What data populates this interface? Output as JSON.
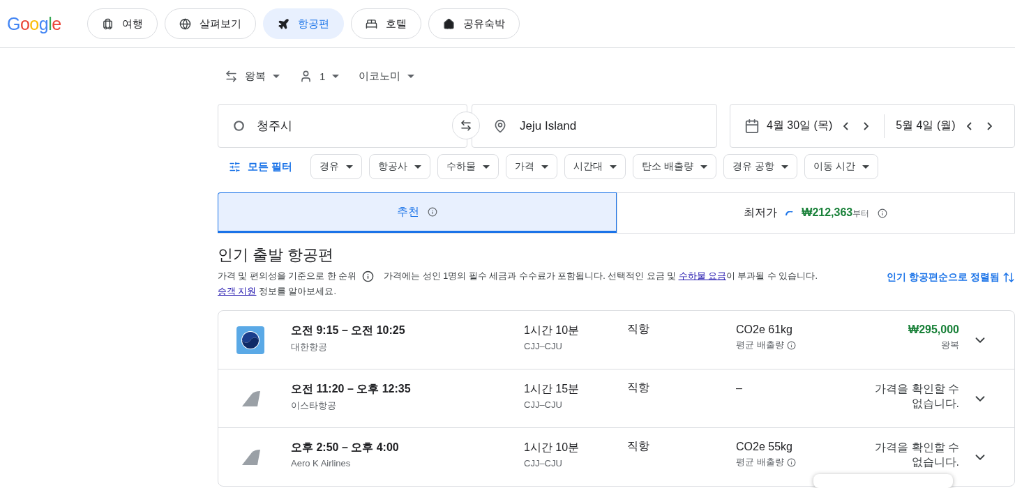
{
  "logo": "Google",
  "nav": [
    {
      "label": "여행",
      "selected": false
    },
    {
      "label": "살펴보기",
      "selected": false
    },
    {
      "label": "항공편",
      "selected": true
    },
    {
      "label": "호텔",
      "selected": false
    },
    {
      "label": "공유숙박",
      "selected": false
    }
  ],
  "options": [
    {
      "kind": "trip",
      "label": "왕복"
    },
    {
      "kind": "people",
      "label": "1"
    },
    {
      "kind": "class",
      "label": "이코노미"
    }
  ],
  "origin": "청주시",
  "destination": "Jeju Island",
  "dates": [
    {
      "label": "4월 30일 (목)"
    },
    {
      "label": "5월 4일 (월)"
    }
  ],
  "all_filters": "모든 필터",
  "filters": [
    "경유",
    "항공사",
    "수하물",
    "가격",
    "시간대",
    "탄소 배출량",
    "경유 공항",
    "이동 시간"
  ],
  "sort_tabs": [
    {
      "label": "추천",
      "selected": true
    },
    {
      "label": "최저가",
      "selected": false,
      "price": "₩212,363",
      "suffix": "부터"
    }
  ],
  "section": {
    "title": "인기 출발 항공편",
    "rank_note": "가격 및 편의성을 기준으로 한 순위",
    "price_note": "가격에는 성인 1명의 필수 세금과 수수료가 포함됩니다. 선택적인 요금 및 ",
    "baggage_link": "수하물 요금",
    "price_note_end": "이 부과될 수 있습니다.",
    "support_link": "승객 지원",
    "support_end": " 정보를 알아보세요.",
    "sort_label": "인기 항공편순으로 정렬됨"
  },
  "flights": [
    {
      "kind": "logo",
      "times": "오전 9:15 – 오전 10:25",
      "airline": "대한항공",
      "duration": "1시간 10분",
      "route": "CJJ–CJU",
      "stops": "직항",
      "emissions": "CO2e 61kg",
      "emissions_note": "평균 배출량",
      "price": "₩295,000",
      "price_note": "왕복"
    },
    {
      "kind": "tail",
      "times": "오전 11:20 – 오후 12:35",
      "airline": "이스타항공",
      "duration": "1시간 15분",
      "route": "CJJ–CJU",
      "stops": "직항",
      "emissions": "–",
      "unavailable": "가격을 확인할 수 없습니다."
    },
    {
      "kind": "tail",
      "times": "오후 2:50 – 오후 4:00",
      "airline": "Aero K Airlines",
      "duration": "1시간 10분",
      "route": "CJJ–CJU",
      "stops": "직항",
      "emissions": "CO2e 55kg",
      "emissions_note": "평균 배출량",
      "unavailable": "가격을 확인할 수 없습니다."
    }
  ]
}
